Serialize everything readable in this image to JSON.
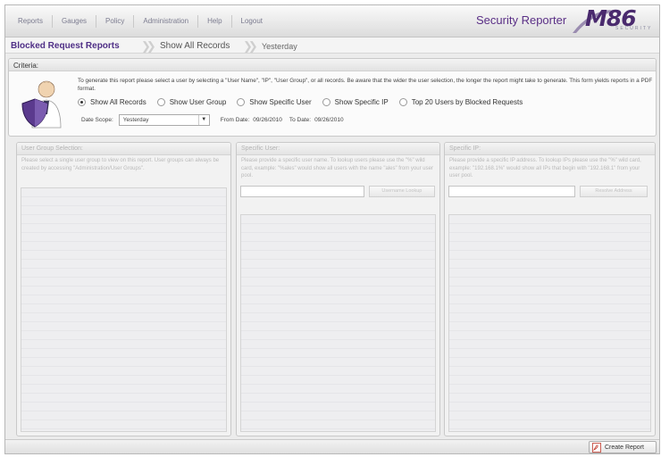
{
  "nav": {
    "items": [
      "Reports",
      "Gauges",
      "Policy",
      "Administration",
      "Help",
      "Logout"
    ]
  },
  "app": {
    "title": "Security Reporter",
    "logo_text": "M86",
    "logo_sub": "SECURITY"
  },
  "breadcrumb": {
    "items": [
      "Blocked Request Reports",
      "Show All Records",
      "Yesterday"
    ]
  },
  "criteria": {
    "title": "Criteria:",
    "description": "To generate this report please select a user by selecting a \"User Name\", \"IP\", \"User Group\", or all records. Be aware that the wider the user selection, the longer the report might take to generate. This form yields reports in a PDF format.",
    "options": [
      {
        "label": "Show All Records",
        "selected": true
      },
      {
        "label": "Show User Group",
        "selected": false
      },
      {
        "label": "Show Specific User",
        "selected": false
      },
      {
        "label": "Show Specific IP",
        "selected": false
      },
      {
        "label": "Top 20 Users by Blocked Requests",
        "selected": false
      }
    ],
    "date_scope_label": "Date Scope:",
    "date_scope_value": "Yesterday",
    "from_label": "From Date:",
    "from_value": "09/26/2010",
    "to_label": "To Date:",
    "to_value": "09/26/2010"
  },
  "panels": {
    "group": {
      "title": "User Group Selection:",
      "description": "Please select a single user group to view on this report. User groups can always be created by accessing \"Administration/User Groups\"."
    },
    "user": {
      "title": "Specific User:",
      "description": "Please provide a specific user name. To lookup users please use the \"%\" wild card, example: \"%ales\" would show all users with the name \"ales\" from your user pool.",
      "button": "Username Lookup"
    },
    "ip": {
      "title": "Specific IP:",
      "description": "Please provide a specific IP address. To lookup IPs please use the \"%\" wild card, example: \"192.168.1%\" would show all IPs that begin with \"192.168.1\" from your user pool.",
      "button": "Resolve Address"
    }
  },
  "footer": {
    "create_button": "Create Report"
  },
  "colors": {
    "brand": "#4f2f86",
    "title": "#5a2f86"
  }
}
